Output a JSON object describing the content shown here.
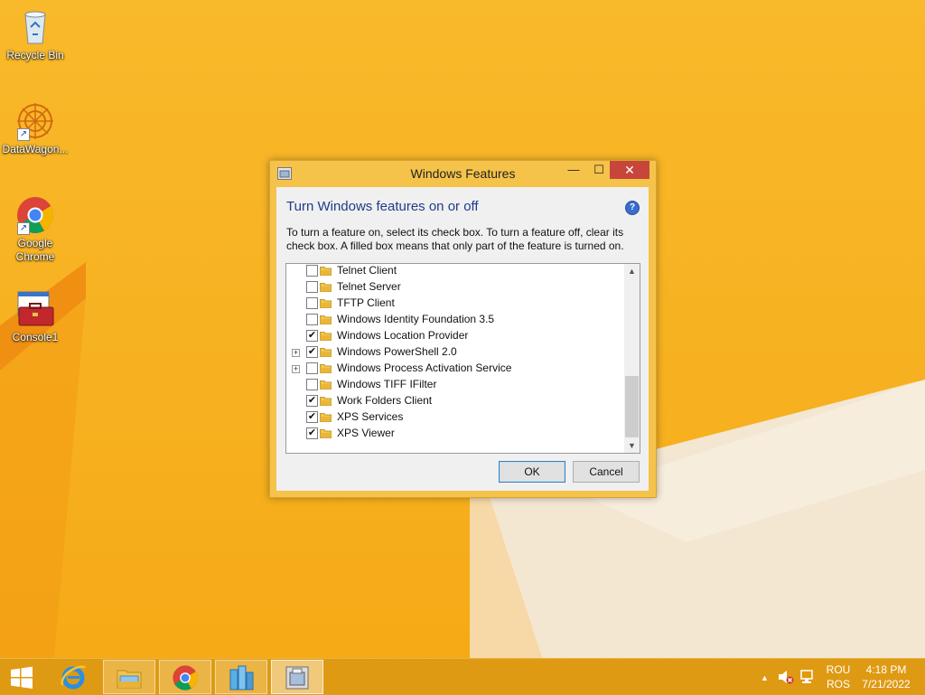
{
  "desktop": {
    "icons": [
      {
        "label": "Recycle Bin"
      },
      {
        "label": "DataWagon..."
      },
      {
        "label": "Google Chrome"
      },
      {
        "label": "Console1"
      }
    ]
  },
  "dialog": {
    "title": "Windows Features",
    "heading": "Turn Windows features on or off",
    "description": "To turn a feature on, select its check box. To turn a feature off, clear its check box. A filled box means that only part of the feature is turned on.",
    "features": [
      {
        "label": "Telnet Client",
        "checked": false,
        "expandable": false
      },
      {
        "label": "Telnet Server",
        "checked": false,
        "expandable": false
      },
      {
        "label": "TFTP Client",
        "checked": false,
        "expandable": false
      },
      {
        "label": "Windows Identity Foundation 3.5",
        "checked": false,
        "expandable": false
      },
      {
        "label": "Windows Location Provider",
        "checked": true,
        "expandable": false
      },
      {
        "label": "Windows PowerShell 2.0",
        "checked": true,
        "expandable": true
      },
      {
        "label": "Windows Process Activation Service",
        "checked": false,
        "expandable": true
      },
      {
        "label": "Windows TIFF IFilter",
        "checked": false,
        "expandable": false
      },
      {
        "label": "Work Folders Client",
        "checked": true,
        "expandable": false
      },
      {
        "label": "XPS Services",
        "checked": true,
        "expandable": false
      },
      {
        "label": "XPS Viewer",
        "checked": true,
        "expandable": false
      }
    ],
    "ok_label": "OK",
    "cancel_label": "Cancel",
    "colors": {
      "heading": "#1e3c8a",
      "close": "#c7463c"
    }
  },
  "taskbar": {
    "items": [
      "start-icon",
      "internet-explorer-icon",
      "file-explorer-icon",
      "chrome-icon",
      "server-manager-icon",
      "windows-features-icon"
    ],
    "language_top": "ROU",
    "language_bottom": "ROS",
    "time": "4:18 PM",
    "date": "7/21/2022"
  }
}
